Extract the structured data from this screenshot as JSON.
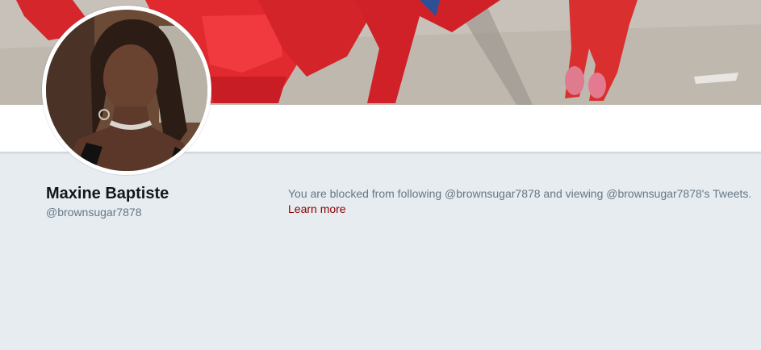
{
  "profile": {
    "name": "Maxine Baptiste",
    "handle": "@brownsugar7878"
  },
  "notice": {
    "blocked_text": "You are blocked from following @brownsugar7878 and viewing @brownsugar7878's Tweets.",
    "learn_more_label": "Learn more"
  },
  "colors": {
    "background": "#e6ecf0",
    "name_text": "#14171a",
    "secondary_text": "#657786",
    "link": "#8b0000",
    "banner_accent": "#e0252b"
  }
}
